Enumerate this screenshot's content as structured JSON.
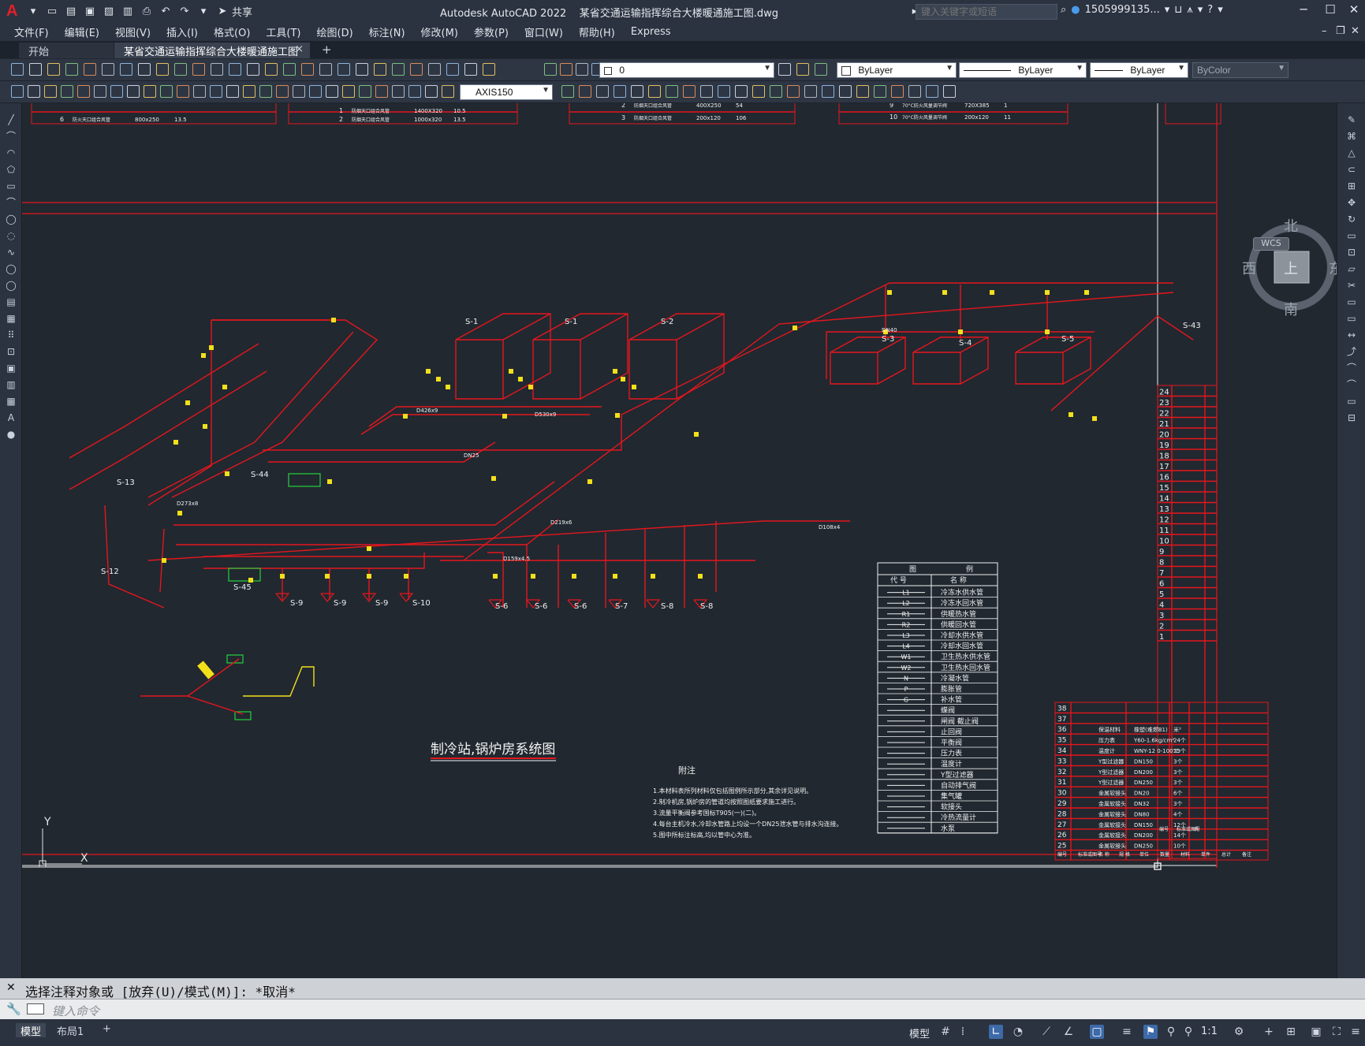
{
  "titlebar": {
    "app_title": "Autodesk AutoCAD 2022    某省交通运输指挥综合大楼暖通施工图.dwg",
    "share_label": "共享",
    "search_placeholder": "键入关键字或短语",
    "user_name": "1505999135..."
  },
  "menu": [
    "文件(F)",
    "编辑(E)",
    "视图(V)",
    "插入(I)",
    "格式(O)",
    "工具(T)",
    "绘图(D)",
    "标注(N)",
    "修改(M)",
    "参数(P)",
    "窗口(W)",
    "帮助(H)",
    "Express"
  ],
  "tabs": {
    "start": "开始",
    "drawing": "某省交通运输指挥综合大楼暖通施工图*",
    "close": "×",
    "add": "+"
  },
  "toolbar": {
    "layer_value": "0",
    "color_value": "ByLayer",
    "linetype_value": "ByLayer",
    "lineweight_value": "ByLayer",
    "plotstyle_value": "ByColor",
    "dimstyle_value": "AXIS150"
  },
  "viewcube": {
    "north": "北",
    "south": "南",
    "east": "东",
    "west": "西",
    "top": "上",
    "wcs": "WCS"
  },
  "drawing": {
    "title": "制冷站,锅炉房系统图",
    "notes_title": "附注",
    "notes": [
      "1.本材料表所列材料仅包括图例所示部分,其余详见说明。",
      "2.制冷机房,锅炉房的管道均按照图纸要求施工进行。",
      "3.流量平衡阀参考国标T905(一)(二)。",
      "4.每台主机冷水,冷却水管路上均设一个DN25泄水管与排水沟连接。",
      "5.图中所标注标高,均以管中心为准。"
    ],
    "legend_title": [
      "图",
      "例"
    ],
    "legend_headers": [
      "代 号",
      "名 称"
    ],
    "legend": [
      {
        "code": "L1",
        "name": "冷冻水供水管"
      },
      {
        "code": "L2",
        "name": "冷冻水回水管"
      },
      {
        "code": "R1",
        "name": "供暖热水管"
      },
      {
        "code": "R2",
        "name": "供暖回水管"
      },
      {
        "code": "L3",
        "name": "冷却水供水管"
      },
      {
        "code": "L4",
        "name": "冷却水回水管"
      },
      {
        "code": "W1",
        "name": "卫生热水供水管"
      },
      {
        "code": "W2",
        "name": "卫生热水回水管"
      },
      {
        "code": "N",
        "name": "冷凝水管"
      },
      {
        "code": "P",
        "name": "膨胀管"
      },
      {
        "code": "G",
        "name": "补水管"
      },
      {
        "code": "",
        "name": "蝶阀"
      },
      {
        "code": "",
        "name": "闸阀    截止阀"
      },
      {
        "code": "",
        "name": "止回阀"
      },
      {
        "code": "",
        "name": "平衡阀"
      },
      {
        "code": "",
        "name": "压力表"
      },
      {
        "code": "",
        "name": "温度计"
      },
      {
        "code": "",
        "name": "Y型过滤器"
      },
      {
        "code": "",
        "name": "自动排气阀"
      },
      {
        "code": "",
        "name": "集气罐"
      },
      {
        "code": "",
        "name": "软接头"
      },
      {
        "code": "",
        "name": "冷热流量计"
      },
      {
        "code": "",
        "name": "水泵"
      }
    ],
    "equipment_labels": [
      "S-1",
      "S-1",
      "S-2",
      "S-3",
      "S-4",
      "S-5",
      "S-43",
      "S-44",
      "S-45",
      "S-13",
      "S-12",
      "S-9",
      "S-9",
      "S-9",
      "S-10",
      "S-6",
      "S-6",
      "S-6",
      "S-7",
      "S-8",
      "S-8"
    ],
    "pipe_labels": [
      "D426x9",
      "D530x9",
      "D273x8",
      "DN25",
      "D219x6",
      "D108x4",
      "DN40",
      "D159x4.5"
    ],
    "material_rows": [
      {
        "no": "38",
        "name": "",
        "spec": "",
        "qty": ""
      },
      {
        "no": "37",
        "name": "",
        "spec": "",
        "qty": ""
      },
      {
        "no": "36",
        "name": "保温材料",
        "spec": "橡塑(难燃B1)",
        "qty": "米³"
      },
      {
        "no": "35",
        "name": "压力表",
        "spec": "Y60-1.6kg/cm²",
        "qty": "24个"
      },
      {
        "no": "34",
        "name": "温度计",
        "spec": "WNY-12 0-100℃",
        "qty": "29个"
      },
      {
        "no": "33",
        "name": "Y型过滤器",
        "spec": "DN150",
        "qty": "3个"
      },
      {
        "no": "32",
        "name": "Y型过滤器",
        "spec": "DN200",
        "qty": "3个"
      },
      {
        "no": "31",
        "name": "Y型过滤器",
        "spec": "DN250",
        "qty": "3个"
      },
      {
        "no": "30",
        "name": "金属软接头",
        "spec": "DN20",
        "qty": "6个"
      },
      {
        "no": "29",
        "name": "金属软接头",
        "spec": "DN32",
        "qty": "3个"
      },
      {
        "no": "28",
        "name": "金属软接头",
        "spec": "DN80",
        "qty": "4个"
      },
      {
        "no": "27",
        "name": "金属软接头",
        "spec": "DN150",
        "qty": "12个"
      },
      {
        "no": "26",
        "name": "金属软接头",
        "spec": "DN200",
        "qty": "14个"
      },
      {
        "no": "25",
        "name": "金属软接头",
        "spec": "DN250",
        "qty": "10个"
      }
    ],
    "material_footer": [
      "编号",
      "标准或图号",
      "名 称",
      "规 格",
      "单位",
      "数量",
      "材料",
      "单件",
      "总计",
      "备注"
    ],
    "right_table_numbers": [
      "24",
      "23",
      "22",
      "21",
      "20",
      "19",
      "18",
      "17",
      "16",
      "15",
      "14",
      "13",
      "12",
      "11",
      "10",
      "9",
      "8",
      "7",
      "6",
      "5",
      "4",
      "3",
      "2",
      "1"
    ],
    "right_table_footer": [
      "编号",
      "标准或图号",
      "名"
    ],
    "top_table_rows": [
      {
        "no": "6",
        "name": "防火天口组合风管",
        "spec": "800x250",
        "qty": "13.5"
      },
      {
        "no": "1",
        "name": "防烟天口组合风管",
        "spec": "1400X320",
        "qty": "10.5"
      },
      {
        "no": "2",
        "name": "防烟天口组合风管",
        "spec": "1000x320",
        "qty": "13.5"
      },
      {
        "no": "2",
        "name": "防烟天口组合风管",
        "spec": "400X250",
        "qty": "54"
      },
      {
        "no": "3",
        "name": "防烟天口组合风管",
        "spec": "200x120",
        "qty": "106"
      },
      {
        "no": "9",
        "name": "70°C防火风量调节阀",
        "spec": "720X385",
        "qty": "1"
      },
      {
        "no": "10",
        "name": "70°C防火风量调节阀",
        "spec": "200x120",
        "qty": "11"
      }
    ],
    "axis_y": "Y",
    "axis_x": "X"
  },
  "command": {
    "history": "选择注释对象或 [放弃(U)/模式(M)]: *取消*",
    "input_placeholder": "键入命令"
  },
  "statusbar": {
    "model_tab": "模型",
    "layout_tab": "布局1",
    "add_tab": "+",
    "model_label": "模型",
    "scale": "1:1"
  }
}
